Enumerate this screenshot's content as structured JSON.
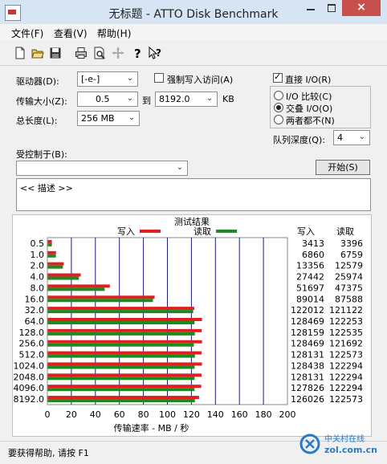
{
  "window": {
    "title": "无标题 - ATTO Disk Benchmark",
    "close_glyph": "×"
  },
  "menu": [
    "文件(F)",
    "查看(V)",
    "帮助(H)"
  ],
  "toolbar": [
    "new-doc-icon",
    "open-folder-icon",
    "save-icon",
    "print-icon",
    "print-preview-icon",
    "move-icon",
    "help-icon",
    "context-help-icon"
  ],
  "form": {
    "drive_label": "驱动器(D):",
    "drive_value": "[-e-]",
    "force_write_label": "强制写入访问(A)",
    "direct_io_label": "直接 I/O(R)",
    "transfer_label": "传输大小(Z):",
    "transfer_from": "0.5",
    "transfer_to_label": "到",
    "transfer_to": "8192.0",
    "transfer_unit": "KB",
    "length_label": "总长度(L):",
    "length_value": "256 MB",
    "io_options": [
      "I/O 比较(C)",
      "交叠 I/O(O)",
      "两者都不(N)"
    ],
    "queue_label": "队列深度(Q):",
    "queue_value": "4",
    "controlled_label": "受控制于(B):",
    "controlled_value": "",
    "start_label": "开始(S)",
    "description": "<< 描述 >>"
  },
  "chart_data": {
    "type": "bar",
    "title": "测试结果",
    "legend_write": "写入",
    "legend_read": "读取",
    "col_write": "写入",
    "col_read": "读取",
    "xlabel": "传输速率 - MB / 秒",
    "xlim": [
      0,
      200
    ],
    "xticks": [
      "0",
      "20",
      "40",
      "60",
      "80",
      "100",
      "120",
      "140",
      "160",
      "180",
      "200"
    ],
    "categories": [
      "0.5",
      "1.0",
      "2.0",
      "4.0",
      "8.0",
      "16.0",
      "32.0",
      "64.0",
      "128.0",
      "256.0",
      "512.0",
      "1024.0",
      "2048.0",
      "4096.0",
      "8192.0"
    ],
    "series": [
      {
        "name": "写入",
        "color": "#e02020",
        "values": [
          3413,
          6860,
          13356,
          27442,
          51697,
          89014,
          122012,
          128469,
          128159,
          128469,
          128131,
          128438,
          128131,
          127826,
          126026
        ]
      },
      {
        "name": "读取",
        "color": "#1e8a1e",
        "values": [
          3396,
          6759,
          12579,
          25974,
          47375,
          87588,
          121122,
          122253,
          122535,
          121692,
          122573,
          122294,
          122294,
          122294,
          122573
        ]
      }
    ],
    "grid_color": "#1a1a80"
  },
  "status": {
    "text": "要获得帮助, 请按 F1"
  },
  "watermark": {
    "cn": "中关村在线",
    "en": "zol.com.cn"
  }
}
